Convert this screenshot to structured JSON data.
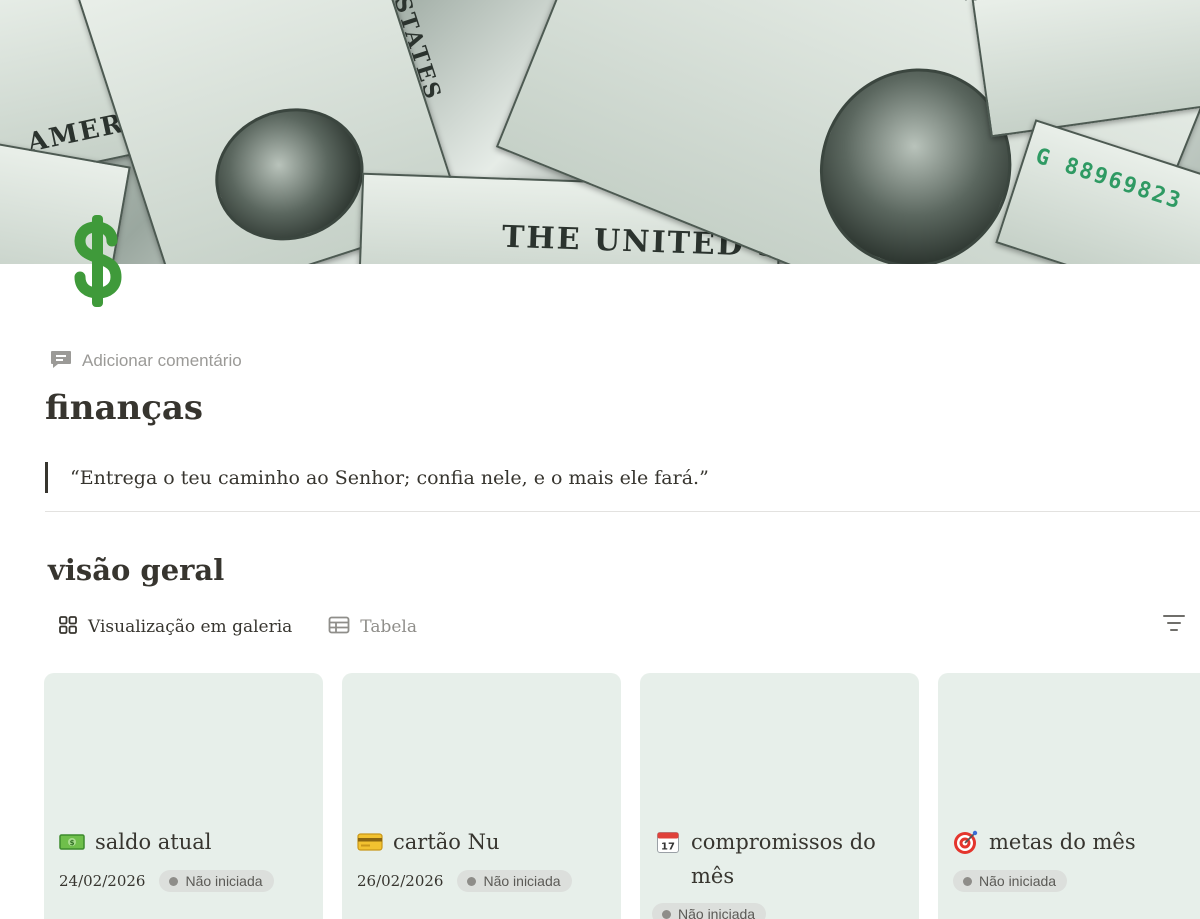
{
  "cover": {
    "image": "dollar-bills-cover"
  },
  "page": {
    "icon": "dollar-sign-icon",
    "add_comment": "Adicionar comentário",
    "title": "finanças",
    "quote": "“Entrega o teu caminho ao Senhor; confia nele, e o mais ele fará.”"
  },
  "overview": {
    "title": "visão geral",
    "views": [
      {
        "label": "Visualização em galeria",
        "icon": "gallery-grid-icon",
        "active": true
      },
      {
        "label": "Tabela",
        "icon": "table-icon",
        "active": false
      }
    ],
    "filter_icon": "filter-lines-icon",
    "cards": [
      {
        "emoji": "dollar-banknote-icon",
        "title": "saldo atual",
        "date": "24/02/2026",
        "status": "Não iniciada"
      },
      {
        "emoji": "credit-card-icon",
        "title": "cartão Nu",
        "date": "26/02/2026",
        "status": "Não iniciada"
      },
      {
        "emoji": "calendar-icon",
        "title": "compromissos do mês",
        "date": "",
        "status": "Não iniciada"
      },
      {
        "emoji": "target-icon",
        "title": "metas do mês",
        "date": "",
        "status": "Não iniciada"
      }
    ]
  },
  "colors": {
    "card_bg": "#e7efea",
    "badge_bg": "#dcdfdc",
    "text": "#37352f",
    "muted": "#9b9a97",
    "dollar_green": "#3f9a3a"
  }
}
